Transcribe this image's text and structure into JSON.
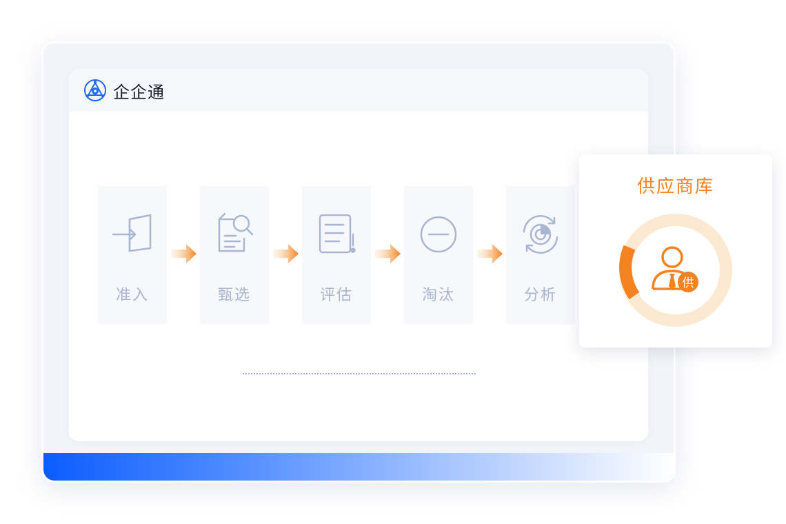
{
  "app": {
    "title": "企企通"
  },
  "steps": [
    {
      "label": "准入",
      "icon": "enter-door-icon"
    },
    {
      "label": "甄选",
      "icon": "document-search-icon"
    },
    {
      "label": "评估",
      "icon": "checklist-alert-icon"
    },
    {
      "label": "淘汰",
      "icon": "minus-circle-icon"
    },
    {
      "label": "分析",
      "icon": "radar-refresh-icon"
    }
  ],
  "supplier_card": {
    "title": "供应商库",
    "badge": "供",
    "icon": "supplier-user-icon"
  },
  "colors": {
    "accent": "#f58220",
    "brand_blue": "#0b5cff",
    "muted_icon": "#a9b5d1",
    "donut_track": "#fde8d1"
  }
}
